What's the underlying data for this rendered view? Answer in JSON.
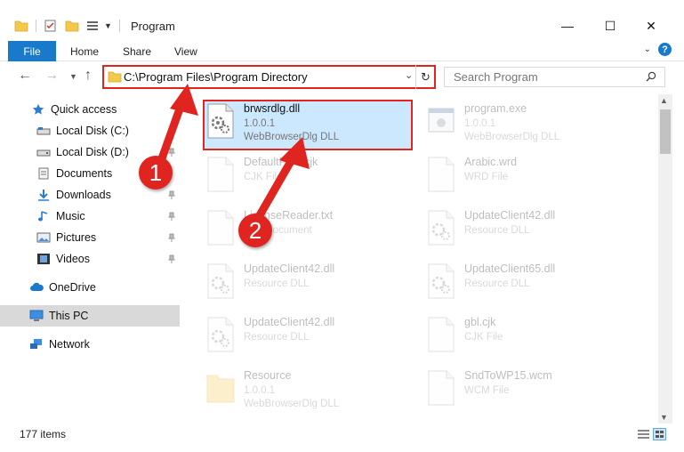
{
  "window": {
    "title": "Program",
    "minimize": "—",
    "maximize": "☐",
    "close": "✕"
  },
  "ribbon": {
    "tabs": [
      "File",
      "Home",
      "Share",
      "View"
    ],
    "help": "?"
  },
  "address_bar": {
    "path": "C:\\Program Files\\Program Directory"
  },
  "search": {
    "placeholder": "Search Program"
  },
  "sidebar": {
    "items": [
      {
        "label": "Quick access",
        "icon": "star-icon"
      },
      {
        "label": "Local Disk (C:)",
        "icon": "drive-icon"
      },
      {
        "label": "Local Disk (D:)",
        "icon": "drive-icon"
      },
      {
        "label": "Documents",
        "icon": "documents-icon"
      },
      {
        "label": "Downloads",
        "icon": "download-icon"
      },
      {
        "label": "Music",
        "icon": "music-icon"
      },
      {
        "label": "Pictures",
        "icon": "pictures-icon"
      },
      {
        "label": "Videos",
        "icon": "videos-icon"
      },
      {
        "label": "OneDrive",
        "icon": "cloud-icon"
      },
      {
        "label": "This PC",
        "icon": "computer-icon"
      },
      {
        "label": "Network",
        "icon": "network-icon"
      }
    ]
  },
  "files": [
    {
      "name": "brwsrdlg.dll",
      "line1": "1.0.0.1",
      "line2": "WebBrowserDlg DLL",
      "type": "dll",
      "selected": true
    },
    {
      "name": "program.exe",
      "line1": "1.0.0.1",
      "line2": "WebBrowserDlg DLL",
      "type": "exe"
    },
    {
      "name": "DefaultFont.cjk",
      "line1": "CJK File",
      "line2": "",
      "type": "doc"
    },
    {
      "name": "Arabic.wrd",
      "line1": "WRD File",
      "line2": "",
      "type": "doc"
    },
    {
      "name": "LicenseReader.txt",
      "line1": "Text Document",
      "line2": "",
      "type": "doc"
    },
    {
      "name": "UpdateClient42.dll",
      "line1": "Resource DLL",
      "line2": "",
      "type": "dll"
    },
    {
      "name": "UpdateClient42.dll",
      "line1": "Resource DLL",
      "line2": "",
      "type": "dll"
    },
    {
      "name": "UpdateClient65.dll",
      "line1": "Resource DLL",
      "line2": "",
      "type": "dll"
    },
    {
      "name": "UpdateClient42.dll",
      "line1": "Resource DLL",
      "line2": "",
      "type": "dll"
    },
    {
      "name": "gbl.cjk",
      "line1": "CJK File",
      "line2": "",
      "type": "doc"
    },
    {
      "name": "Resource",
      "line1": "1.0.0.1",
      "line2": "WebBrowserDlg DLL",
      "type": "folder"
    },
    {
      "name": "SndToWP15.wcm",
      "line1": "WCM File",
      "line2": "",
      "type": "doc"
    }
  ],
  "status": {
    "items_count": "177 items"
  },
  "annotations": {
    "badge1": "1",
    "badge2": "2"
  },
  "colors": {
    "accent": "#1979ca",
    "annotation": "#e0241f",
    "selection": "#cce8ff"
  }
}
